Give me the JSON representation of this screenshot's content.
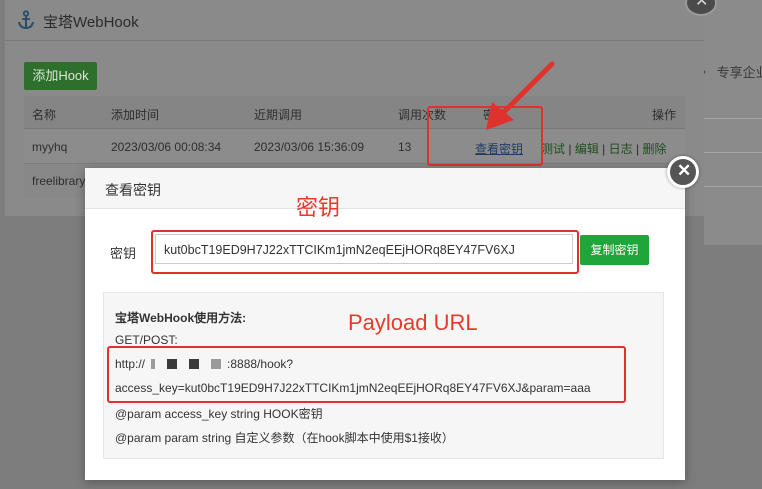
{
  "background": {
    "right_label": "专享企业"
  },
  "back_dialog": {
    "title": "宝塔WebHook",
    "add_button": "添加Hook",
    "close_icon": "close-icon",
    "columns": [
      "名称",
      "添加时间",
      "近期调用",
      "调用次数",
      "密钥",
      "操作"
    ],
    "rows": [
      {
        "name": "myyhq",
        "added": "2023/03/06 00:08:34",
        "recent": "2023/03/06 15:36:09",
        "count": "13",
        "key_link": "查看密钥",
        "actions": [
          "测试",
          "编辑",
          "日志",
          "删除"
        ]
      },
      {
        "name": "freelibrary"
      }
    ]
  },
  "front_dialog": {
    "title": "查看密钥",
    "key_label": "密钥",
    "key_value": "kut0bcT19ED9H7J22xTTCIKm1jmN2eqEEjHORq8EY47FV6XJ",
    "copy_button": "复制密钥",
    "usage": {
      "title": "宝塔WebHook使用方法:",
      "method": "GET/POST:",
      "url_prefix": "http://",
      "url_suffix": ":8888/hook?",
      "url_query": "access_key=kut0bcT19ED9H7J22xTTCIKm1jmN2eqEEjHORq8EY47FV6XJ&param=aaa",
      "param1": "@param access_key string HOOK密钥",
      "param2": "@param param string 自定义参数（在hook脚本中使用$1接收）"
    }
  },
  "annotations": {
    "key_label": "密钥",
    "url_label": "Payload URL",
    "color": "#e83a2c"
  },
  "colors": {
    "accent_green": "#20a53a",
    "annotation_red": "#e0322d"
  }
}
